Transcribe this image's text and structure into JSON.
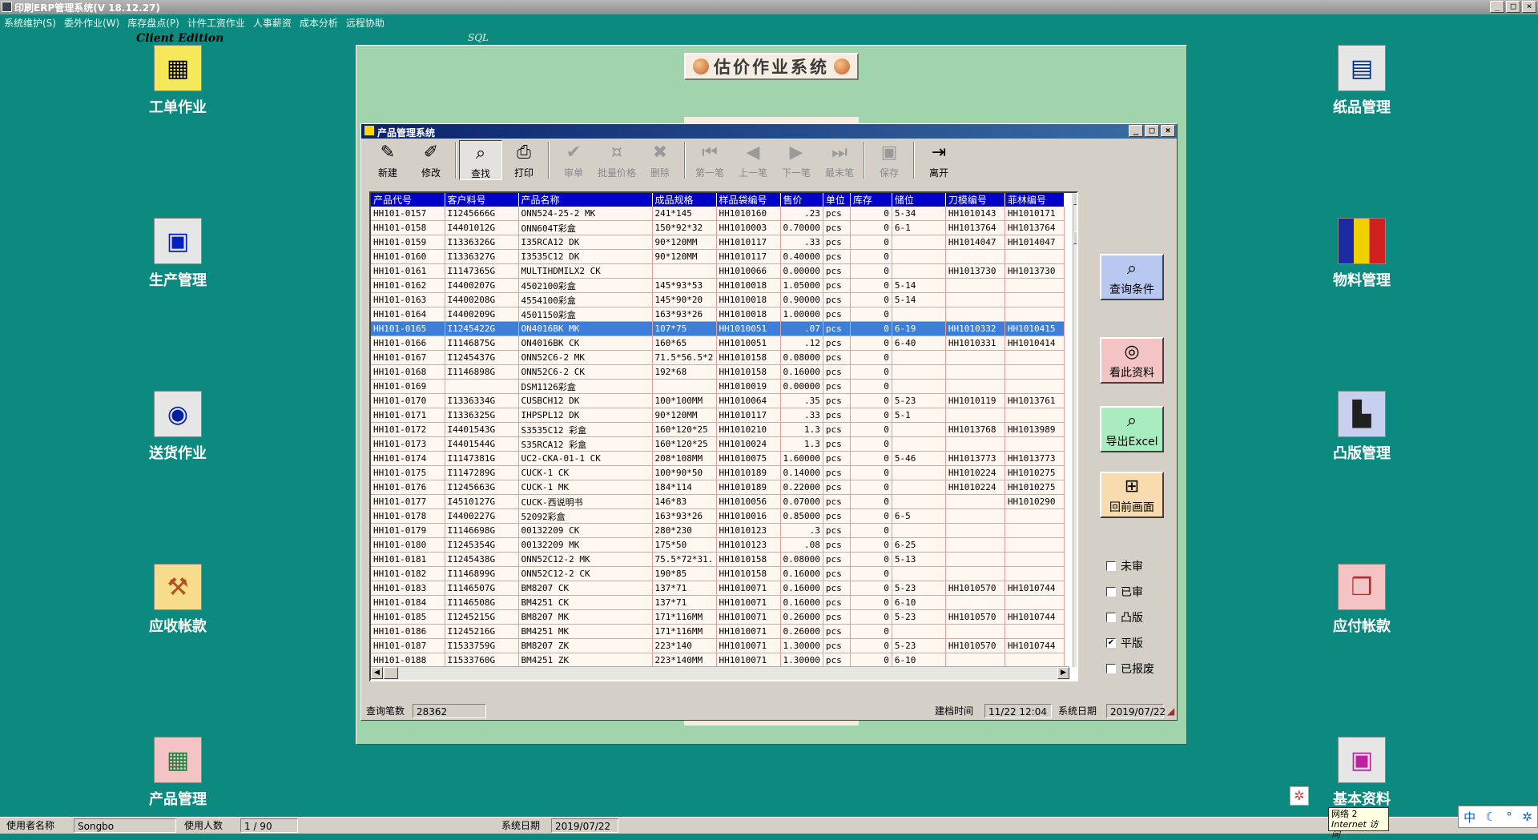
{
  "app": {
    "title": "印刷ERP管理系统(V 18.12.27)",
    "edition": "Client Edition",
    "db": "SQL",
    "win_min": "_",
    "win_max": "□",
    "win_close": "×"
  },
  "menu": [
    "系统维护(S)",
    "委外作业(W)",
    "库存盘点(P)",
    "计件工资作业",
    "人事薪资",
    "成本分析",
    "远程协助"
  ],
  "desktop_left": [
    "工单作业",
    "生产管理",
    "送货作业",
    "应收帐款",
    "产品管理"
  ],
  "desktop_right": [
    "纸品管理",
    "物料管理",
    "凸版管理",
    "应付帐款",
    "基本资料"
  ],
  "banner": {
    "title": "估价作业系统"
  },
  "pm_window": {
    "title": "产品管理系统",
    "toolbar": [
      {
        "label": "新建",
        "icon": "✎",
        "enabled": true
      },
      {
        "label": "修改",
        "icon": "✐",
        "enabled": true
      },
      {
        "label": "查找",
        "icon": "⌕",
        "enabled": true,
        "active": true
      },
      {
        "label": "打印",
        "icon": "⎙",
        "enabled": true
      },
      {
        "label": "审单",
        "icon": "✔",
        "enabled": false
      },
      {
        "label": "批量价格",
        "icon": "¤",
        "enabled": false
      },
      {
        "label": "删除",
        "icon": "✖",
        "enabled": false
      },
      {
        "label": "第一笔",
        "icon": "⏮",
        "enabled": false
      },
      {
        "label": "上一笔",
        "icon": "◀",
        "enabled": false
      },
      {
        "label": "下一笔",
        "icon": "▶",
        "enabled": false
      },
      {
        "label": "最末笔",
        "icon": "⏭",
        "enabled": false
      },
      {
        "label": "保存",
        "icon": "▣",
        "enabled": false
      },
      {
        "label": "离开",
        "icon": "⇥",
        "enabled": true
      }
    ],
    "columns": [
      "产品代号",
      "客户料号",
      "产品名称",
      "成品规格",
      "样品袋编号",
      "售价",
      "单位",
      "库存",
      "储位",
      "刀模编号",
      "菲林编号"
    ],
    "rows": [
      [
        "HH101-0157",
        "I1245666G",
        "ONN524-25-2 MK",
        "241*145",
        "HH1010160",
        ".23",
        "pcs",
        "0",
        "5-34",
        "HH1010143",
        "HH1010171"
      ],
      [
        "HH101-0158",
        "I4401012G",
        "ONN604T彩盒",
        "150*92*32",
        "HH1010003",
        "0.70000",
        "pcs",
        "0",
        "6-1",
        "HH1013764",
        "HH1013764"
      ],
      [
        "HH101-0159",
        "I1336326G",
        "I35RCA12 DK",
        "90*120MM",
        "HH1010117",
        ".33",
        "pcs",
        "0",
        "",
        "HH1014047",
        "HH1014047"
      ],
      [
        "HH101-0160",
        "I1336327G",
        "I3535C12 DK",
        "90*120MM",
        "HH1010117",
        "0.40000",
        "pcs",
        "0",
        "",
        "",
        ""
      ],
      [
        "HH101-0161",
        "I1147365G",
        "MULTIHDMILX2 CK",
        "",
        "HH1010066",
        "0.00000",
        "pcs",
        "0",
        "",
        "HH1013730",
        "HH1013730"
      ],
      [
        "HH101-0162",
        "I4400207G",
        "4502100彩盒",
        "145*93*53",
        "HH1010018",
        "1.05000",
        "pcs",
        "0",
        "5-14",
        "",
        ""
      ],
      [
        "HH101-0163",
        "I4400208G",
        "4554100彩盒",
        "145*90*20",
        "HH1010018",
        "0.90000",
        "pcs",
        "0",
        "5-14",
        "",
        ""
      ],
      [
        "HH101-0164",
        "I4400209G",
        "4501150彩盒",
        "163*93*26",
        "HH1010018",
        "1.00000",
        "pcs",
        "0",
        "",
        "",
        ""
      ],
      [
        "HH101-0165",
        "I1245422G",
        "ON4016BK MK",
        "107*75",
        "HH1010051",
        ".07",
        "pcs",
        "0",
        "6-19",
        "HH1010332",
        "HH1010415"
      ],
      [
        "HH101-0166",
        "I1146875G",
        "ON4016BK CK",
        "160*65",
        "HH1010051",
        ".12",
        "pcs",
        "0",
        "6-40",
        "HH1010331",
        "HH1010414"
      ],
      [
        "HH101-0167",
        "I1245437G",
        "ONN52C6-2 MK",
        "71.5*56.5*2",
        "HH1010158",
        "0.08000",
        "pcs",
        "0",
        "",
        "",
        ""
      ],
      [
        "HH101-0168",
        "I1146898G",
        "ONN52C6-2 CK",
        "192*68",
        "HH1010158",
        "0.16000",
        "pcs",
        "0",
        "",
        "",
        ""
      ],
      [
        "HH101-0169",
        "",
        "DSM1126彩盒",
        "",
        "HH1010019",
        "0.00000",
        "pcs",
        "0",
        "",
        "",
        ""
      ],
      [
        "HH101-0170",
        "I1336334G",
        "CUSBCH12 DK",
        "100*100MM",
        "HH1010064",
        ".35",
        "pcs",
        "0",
        "5-23",
        "HH1010119",
        "HH1013761"
      ],
      [
        "HH101-0171",
        "I1336325G",
        "IHPSPL12 DK",
        "90*120MM",
        "HH1010117",
        ".33",
        "pcs",
        "0",
        "5-1",
        "",
        ""
      ],
      [
        "HH101-0172",
        "I4401543G",
        "S3535C12 彩盒",
        "160*120*25",
        "HH1010210",
        "1.3",
        "pcs",
        "0",
        "",
        "HH1013768",
        "HH1013989"
      ],
      [
        "HH101-0173",
        "I4401544G",
        "S35RCA12 彩盒",
        "160*120*25",
        "HH1010024",
        "1.3",
        "pcs",
        "0",
        "",
        "",
        ""
      ],
      [
        "HH101-0174",
        "I1147381G",
        "UC2-CKA-01-1 CK",
        "208*108MM",
        "HH1010075",
        "1.60000",
        "pcs",
        "0",
        "5-46",
        "HH1013773",
        "HH1013773"
      ],
      [
        "HH101-0175",
        "I1147289G",
        "CUCK-1 CK",
        "100*90*50",
        "HH1010189",
        "0.14000",
        "pcs",
        "0",
        "",
        "HH1010224",
        "HH1010275"
      ],
      [
        "HH101-0176",
        "I1245663G",
        "CUCK-1 MK",
        "184*114",
        "HH1010189",
        "0.22000",
        "pcs",
        "0",
        "",
        "HH1010224",
        "HH1010275"
      ],
      [
        "HH101-0177",
        "I4510127G",
        "CUCK-西说明书",
        "146*83",
        "HH1010056",
        "0.07000",
        "pcs",
        "0",
        "",
        "",
        "HH1010290"
      ],
      [
        "HH101-0178",
        "I4400227G",
        "52092彩盒",
        "163*93*26",
        "HH1010016",
        "0.85000",
        "pcs",
        "0",
        "6-5",
        "",
        ""
      ],
      [
        "HH101-0179",
        "I1146698G",
        "00132209 CK",
        "280*230",
        "HH1010123",
        ".3",
        "pcs",
        "0",
        "",
        "",
        ""
      ],
      [
        "HH101-0180",
        "I1245354G",
        "00132209 MK",
        "175*50",
        "HH1010123",
        ".08",
        "pcs",
        "0",
        "6-25",
        "",
        ""
      ],
      [
        "HH101-0181",
        "I1245438G",
        "ONN52C12-2 MK",
        "75.5*72*31.",
        "HH1010158",
        "0.08000",
        "pcs",
        "0",
        "5-13",
        "",
        ""
      ],
      [
        "HH101-0182",
        "I1146899G",
        "ONN52C12-2 CK",
        "190*85",
        "HH1010158",
        "0.16000",
        "pcs",
        "0",
        "",
        "",
        ""
      ],
      [
        "HH101-0183",
        "I1146507G",
        "BM8207 CK",
        "137*71",
        "HH1010071",
        "0.16000",
        "pcs",
        "0",
        "5-23",
        "HH1010570",
        "HH1010744"
      ],
      [
        "HH101-0184",
        "I1146508G",
        "BM4251 CK",
        "137*71",
        "HH1010071",
        "0.16000",
        "pcs",
        "0",
        "6-10",
        "",
        ""
      ],
      [
        "HH101-0185",
        "I1245215G",
        "BM8207 MK",
        "171*116MM",
        "HH1010071",
        "0.26000",
        "pcs",
        "0",
        "5-23",
        "HH1010570",
        "HH1010744"
      ],
      [
        "HH101-0186",
        "I1245216G",
        "BM4251 MK",
        "171*116MM",
        "HH1010071",
        "0.26000",
        "pcs",
        "0",
        "",
        "",
        ""
      ],
      [
        "HH101-0187",
        "I1533759G",
        "BM8207 ZK",
        "223*140",
        "HH1010071",
        "1.30000",
        "pcs",
        "0",
        "5-23",
        "HH1010570",
        "HH1010744"
      ],
      [
        "HH101-0188",
        "I1533760G",
        "BM4251 ZK",
        "223*140MM",
        "HH1010071",
        "1.30000",
        "pcs",
        "0",
        "6-10",
        "",
        ""
      ]
    ],
    "selected_row": 8,
    "side_buttons": [
      "查询条件",
      "看此资料",
      "导出Excel",
      "回前画面"
    ],
    "filters": [
      {
        "label": "未审",
        "checked": false
      },
      {
        "label": "已审",
        "checked": false
      },
      {
        "label": "凸版",
        "checked": false
      },
      {
        "label": "平版",
        "checked": true
      },
      {
        "label": "已报废",
        "checked": false
      }
    ],
    "status": {
      "count_label": "查询笔数",
      "count_value": "28362",
      "build_label": "建档时间",
      "build_value": "11/22 12:04",
      "sysdate_label": "系统日期",
      "sysdate_value": "2019/07/22"
    }
  },
  "bottom_status": {
    "user_label": "使用者名称",
    "user_value": "Songbo",
    "users_label": "使用人数",
    "users_value": "1 / 90",
    "date_label": "系统日期",
    "date_value": "2019/07/22"
  },
  "tray": {
    "network_label": "网络 2",
    "network_sub": "Internet 访问",
    "ime": "中"
  }
}
